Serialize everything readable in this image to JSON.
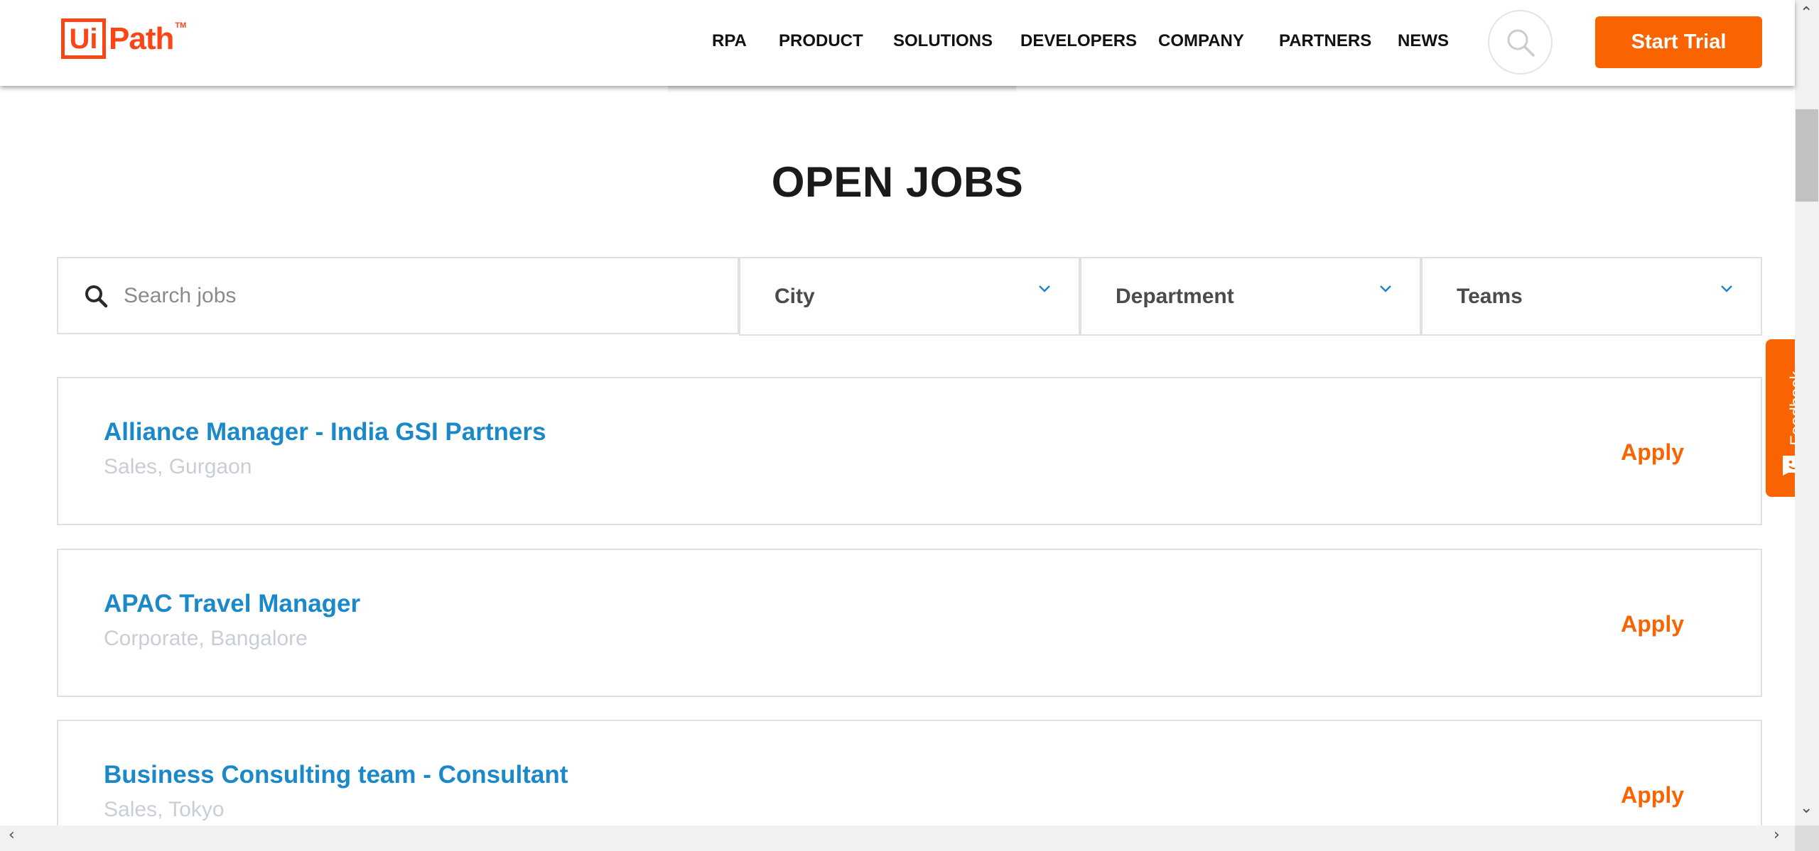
{
  "header": {
    "logo_ui": "Ui",
    "logo_path": "Path",
    "logo_tm": "TM",
    "nav": [
      "RPA",
      "PRODUCT",
      "SOLUTIONS",
      "DEVELOPERS",
      "COMPANY",
      "PARTNERS",
      "NEWS"
    ],
    "search_icon": "search-icon",
    "start_trial": "Start Trial"
  },
  "page": {
    "title": "OPEN JOBS"
  },
  "filters": {
    "search_placeholder": "Search jobs",
    "city": "City",
    "department": "Department",
    "teams": "Teams"
  },
  "jobs": [
    {
      "title": "Alliance Manager - India GSI Partners",
      "meta": "Sales, Gurgaon",
      "apply": "Apply"
    },
    {
      "title": "APAC Travel Manager",
      "meta": "Corporate, Bangalore",
      "apply": "Apply"
    },
    {
      "title": "Business Consulting team - Consultant",
      "meta": "Sales, Tokyo",
      "apply": "Apply"
    }
  ],
  "feedback": {
    "label": "Feedback"
  },
  "colors": {
    "brand_orange": "#fa6400",
    "logo_orange": "#fa4616",
    "job_title_blue": "#1a88c9"
  }
}
